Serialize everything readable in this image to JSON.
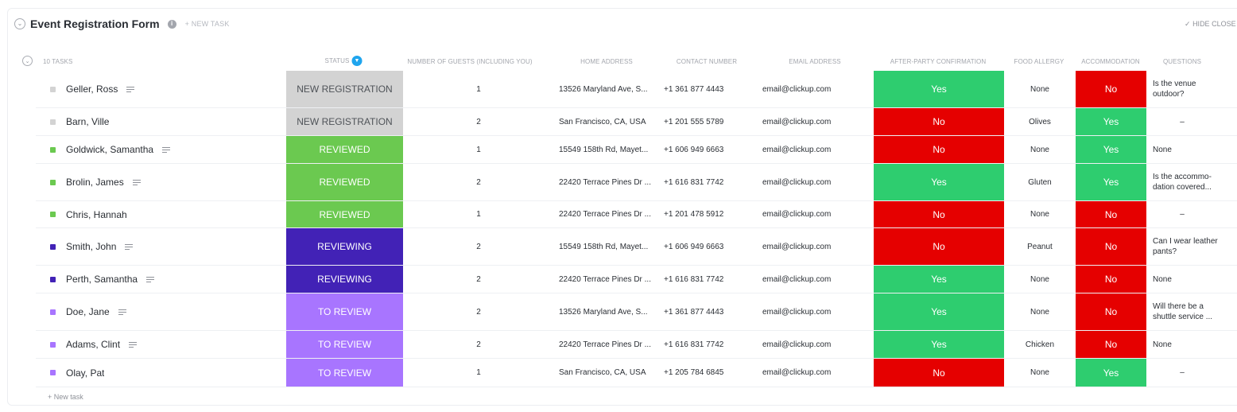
{
  "list": {
    "title": "Event Registration Form",
    "new_task_top": "+ NEW TASK",
    "hide_closed": "HIDE CLOSE",
    "task_count": "10 TASKS",
    "new_task_bottom": "+ New task"
  },
  "columns": {
    "status": "STATUS",
    "guests": "NUMBER OF GUESTS (INCLUDING YOU)",
    "address": "HOME ADDRESS",
    "contact": "CONTACT NUMBER",
    "email": "EMAIL ADDRESS",
    "afterparty": "AFTER-PARTY CONFIRMATION",
    "allergy": "FOOD ALLERGY",
    "accommodation": "ACCOMMODATION",
    "questions": "QUESTIONS"
  },
  "colors": {
    "new_registration": "#d3d3d3",
    "reviewed": "#6bc950",
    "reviewing": "#4222b6",
    "to_review": "#a875ff",
    "yes": "#2ecd6f",
    "no": "#e50000"
  },
  "rows": [
    {
      "name": "Geller, Ross",
      "status": "NEW REGISTRATION",
      "status_key": "new_registration",
      "guests": "1",
      "address": "13526 Maryland Ave, S...",
      "contact": "+1 361 877 4443",
      "email": "email@clickup.com",
      "afterparty": "Yes",
      "allergy": "None",
      "accommodation": "No",
      "questions": "Is the venue outdoor?",
      "has_desc": true
    },
    {
      "name": "Barn, Ville",
      "status": "NEW REGISTRATION",
      "status_key": "new_registration",
      "guests": "2",
      "address": "San Francisco, CA, USA",
      "contact": "+1 201 555 5789",
      "email": "email@clickup.com",
      "afterparty": "No",
      "allergy": "Olives",
      "accommodation": "Yes",
      "questions": "–",
      "has_desc": false
    },
    {
      "name": "Goldwick, Samantha",
      "status": "REVIEWED",
      "status_key": "reviewed",
      "guests": "1",
      "address": "15549 158th Rd, Mayet...",
      "contact": "+1 606 949 6663",
      "email": "email@clickup.com",
      "afterparty": "No",
      "allergy": "None",
      "accommodation": "Yes",
      "questions": "None",
      "has_desc": true
    },
    {
      "name": "Brolin, James",
      "status": "REVIEWED",
      "status_key": "reviewed",
      "guests": "2",
      "address": "22420 Terrace Pines Dr ...",
      "contact": "+1 616 831 7742",
      "email": "email@clickup.com",
      "afterparty": "Yes",
      "allergy": "Gluten",
      "accommodation": "Yes",
      "questions": "Is the accommo-dation covered...",
      "has_desc": true
    },
    {
      "name": "Chris, Hannah",
      "status": "REVIEWED",
      "status_key": "reviewed",
      "guests": "1",
      "address": "22420 Terrace Pines Dr ...",
      "contact": "+1 201 478 5912",
      "email": "email@clickup.com",
      "afterparty": "No",
      "allergy": "None",
      "accommodation": "No",
      "questions": "–",
      "has_desc": false
    },
    {
      "name": "Smith, John",
      "status": "REVIEWING",
      "status_key": "reviewing",
      "guests": "2",
      "address": "15549 158th Rd, Mayet...",
      "contact": "+1 606 949 6663",
      "email": "email@clickup.com",
      "afterparty": "No",
      "allergy": "Peanut",
      "accommodation": "No",
      "questions": "Can I wear leather pants?",
      "has_desc": true
    },
    {
      "name": "Perth, Samantha",
      "status": "REVIEWING",
      "status_key": "reviewing",
      "guests": "2",
      "address": "22420 Terrace Pines Dr ...",
      "contact": "+1 616 831 7742",
      "email": "email@clickup.com",
      "afterparty": "Yes",
      "allergy": "None",
      "accommodation": "No",
      "questions": "None",
      "has_desc": true
    },
    {
      "name": "Doe, Jane",
      "status": "TO REVIEW",
      "status_key": "to_review",
      "guests": "2",
      "address": "13526 Maryland Ave, S...",
      "contact": "+1 361 877 4443",
      "email": "email@clickup.com",
      "afterparty": "Yes",
      "allergy": "None",
      "accommodation": "No",
      "questions": "Will there be a shuttle service ...",
      "has_desc": true
    },
    {
      "name": "Adams, Clint",
      "status": "TO REVIEW",
      "status_key": "to_review",
      "guests": "2",
      "address": "22420 Terrace Pines Dr ...",
      "contact": "+1 616 831 7742",
      "email": "email@clickup.com",
      "afterparty": "Yes",
      "allergy": "Chicken",
      "accommodation": "No",
      "questions": "None",
      "has_desc": true
    },
    {
      "name": "Olay, Pat",
      "status": "TO REVIEW",
      "status_key": "to_review",
      "guests": "1",
      "address": "San Francisco, CA, USA",
      "contact": "+1 205 784 6845",
      "email": "email@clickup.com",
      "afterparty": "No",
      "allergy": "None",
      "accommodation": "Yes",
      "questions": "–",
      "has_desc": false
    }
  ]
}
